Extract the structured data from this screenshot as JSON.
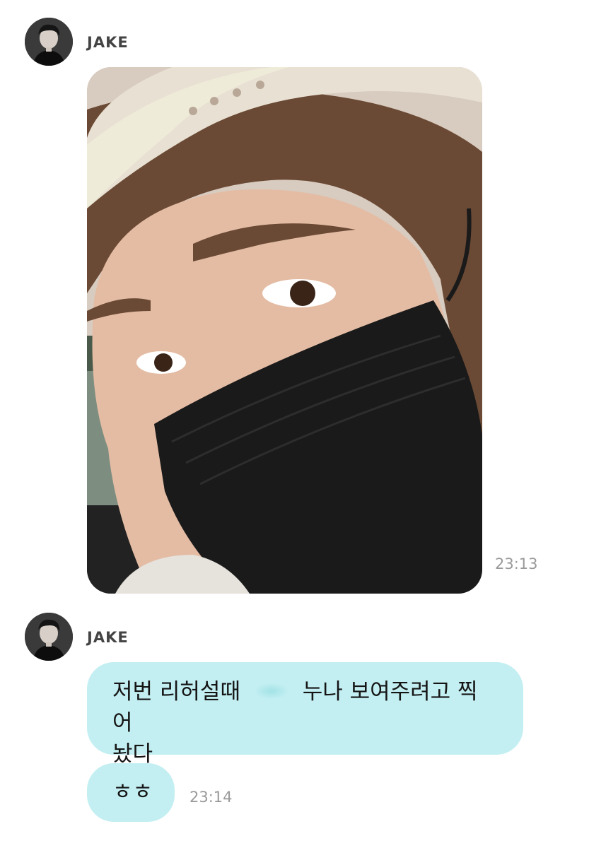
{
  "messages": [
    {
      "sender": "JAKE",
      "type": "image",
      "time": "23:13"
    },
    {
      "sender": "JAKE",
      "type": "text",
      "text_part1": "저번 리허설때",
      "text_part2": "누나 보여주려고 찍어",
      "text_line2": "놨다"
    },
    {
      "type": "text",
      "text": "ㅎㅎ",
      "time": "23:14"
    }
  ],
  "colors": {
    "bubble": "#c4eff2",
    "timestamp": "#9a9a9a",
    "sender": "#444444"
  }
}
